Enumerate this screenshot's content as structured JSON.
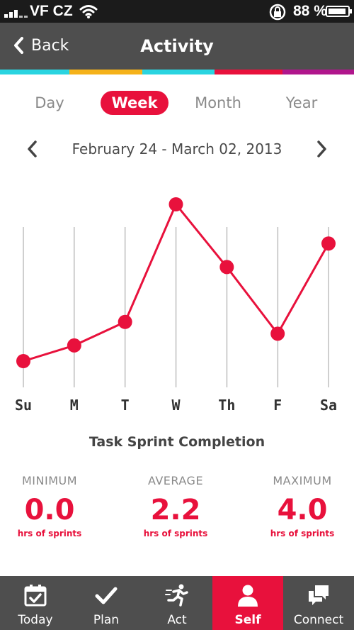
{
  "status_bar": {
    "carrier": "VF CZ",
    "battery_percent": "88 %",
    "icons": [
      "signal-icon",
      "wifi-icon",
      "rotation-lock-icon",
      "battery-icon"
    ]
  },
  "nav": {
    "back_label": "Back",
    "title": "Activity"
  },
  "colors": {
    "accent": "#e8113c",
    "nav_bg": "#4e4e4e",
    "strip": [
      "#2ad4e0",
      "#f5b21a",
      "#2ad4e0",
      "#e8113c",
      "#b0168c"
    ]
  },
  "period_tabs": [
    {
      "label": "Day",
      "active": false
    },
    {
      "label": "Week",
      "active": true
    },
    {
      "label": "Month",
      "active": false
    },
    {
      "label": "Year",
      "active": false
    }
  ],
  "date_range": "February 24 - March 02, 2013",
  "chart_data": {
    "type": "line",
    "categories": [
      "Su",
      "M",
      "T",
      "W",
      "Th",
      "F",
      "Sa"
    ],
    "values": [
      0.0,
      0.4,
      1.0,
      4.0,
      2.4,
      0.7,
      3.0
    ],
    "ylim": [
      0,
      4.0
    ],
    "grid": "vertical",
    "title": "Task Sprint Completion"
  },
  "stats": [
    {
      "label": "MINIMUM",
      "value": "0.0",
      "unit": "hrs of sprints"
    },
    {
      "label": "AVERAGE",
      "value": "2.2",
      "unit": "hrs of sprints"
    },
    {
      "label": "MAXIMUM",
      "value": "4.0",
      "unit": "hrs of sprints"
    }
  ],
  "tab_bar": [
    {
      "label": "Today",
      "icon": "calendar-icon",
      "active": false
    },
    {
      "label": "Plan",
      "icon": "checkmark-icon",
      "active": false
    },
    {
      "label": "Act",
      "icon": "running-person-icon",
      "active": false
    },
    {
      "label": "Self",
      "icon": "person-icon",
      "active": true
    },
    {
      "label": "Connect",
      "icon": "chat-bubbles-icon",
      "active": false
    }
  ]
}
